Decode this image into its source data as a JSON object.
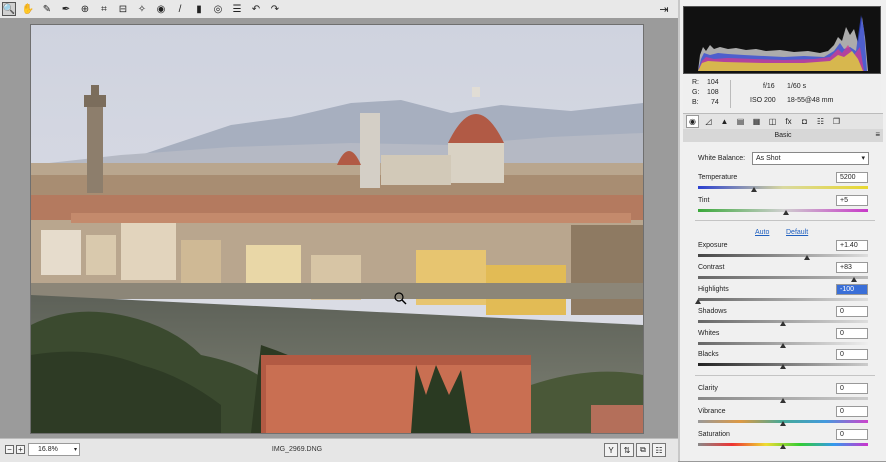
{
  "toolbar": {
    "tools": [
      {
        "name": "zoom-tool-icon",
        "glyph": "🔍",
        "active": true
      },
      {
        "name": "hand-tool-icon",
        "glyph": "✋"
      },
      {
        "name": "white-balance-tool-icon",
        "glyph": "✎"
      },
      {
        "name": "color-sampler-tool-icon",
        "glyph": "✒"
      },
      {
        "name": "targeted-adjustment-tool-icon",
        "glyph": "⊕"
      },
      {
        "name": "crop-tool-icon",
        "glyph": "⌗"
      },
      {
        "name": "straighten-tool-icon",
        "glyph": "⊟"
      },
      {
        "name": "spot-removal-tool-icon",
        "glyph": "✧"
      },
      {
        "name": "red-eye-tool-icon",
        "glyph": "◉"
      },
      {
        "name": "adjustment-brush-icon",
        "glyph": "/"
      },
      {
        "name": "graduated-filter-icon",
        "glyph": "▮"
      },
      {
        "name": "radial-filter-icon",
        "glyph": "◎"
      },
      {
        "name": "preferences-icon",
        "glyph": "☰"
      },
      {
        "name": "rotate-left-icon",
        "glyph": "↶"
      },
      {
        "name": "rotate-right-icon",
        "glyph": "↷"
      }
    ],
    "export_glyph": "⇥"
  },
  "status": {
    "minus": "−",
    "plus": "+",
    "zoom": "16.8%",
    "zoom_arrow": "▾",
    "filename": "IMG_2969.DNG",
    "buttons": [
      "Y",
      "⇅",
      "⧉",
      "☷"
    ]
  },
  "readout": {
    "r_label": "R:",
    "r": "104",
    "g_label": "G:",
    "g": "108",
    "b_label": "B:",
    "b": "74",
    "aperture": "f/16",
    "shutter": "1/60 s",
    "iso": "ISO 200",
    "lens": "18-55@48 mm"
  },
  "panel": {
    "tabs": [
      "◉",
      "◿",
      "▲",
      "▤",
      "▦",
      "◫",
      "fx",
      "◘",
      "☷",
      "❐"
    ],
    "section": "Basic",
    "menu_glyph": "≡",
    "wb_label": "White Balance:",
    "wb_value": "As Shot",
    "wb_arrow": "▾",
    "auto": "Auto",
    "default": "Default",
    "controls": [
      {
        "label": "Temperature",
        "value": "5200",
        "pos": 0.33,
        "track": "temp"
      },
      {
        "label": "Tint",
        "value": "+5",
        "pos": 0.52,
        "track": "tint"
      },
      {
        "label": "Exposure",
        "value": "+1.40",
        "pos": 0.64,
        "track": "gray"
      },
      {
        "label": "Contrast",
        "value": "+83",
        "pos": 0.92,
        "track": "gray"
      },
      {
        "label": "Highlights",
        "value": "-100",
        "pos": 0.0,
        "track": "gray",
        "selected": true
      },
      {
        "label": "Shadows",
        "value": "0",
        "pos": 0.5,
        "track": "gray"
      },
      {
        "label": "Whites",
        "value": "0",
        "pos": 0.5,
        "track": "gray"
      },
      {
        "label": "Blacks",
        "value": "0",
        "pos": 0.5,
        "track": "gray"
      },
      {
        "label": "Clarity",
        "value": "0",
        "pos": 0.5,
        "track": "gray"
      },
      {
        "label": "Vibrance",
        "value": "0",
        "pos": 0.5,
        "track": "vib"
      },
      {
        "label": "Saturation",
        "value": "0",
        "pos": 0.5,
        "track": "sat"
      }
    ]
  }
}
